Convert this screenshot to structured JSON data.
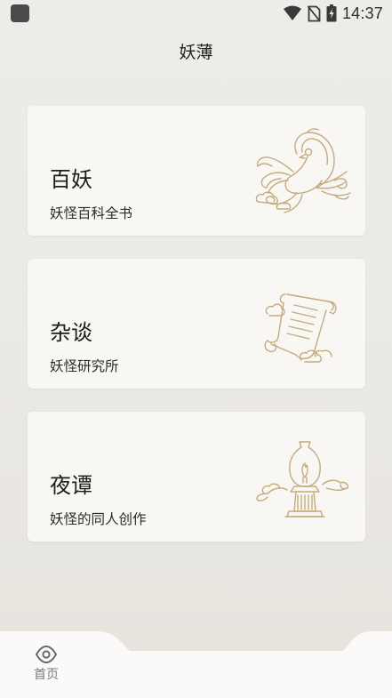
{
  "status_bar": {
    "time": "14:37",
    "icons": [
      "app-notification-icon",
      "wifi-icon",
      "no-sim-icon",
      "battery-charging-icon"
    ]
  },
  "app": {
    "title": "妖薄"
  },
  "cards": [
    {
      "title": "百妖",
      "subtitle": "妖怪百科全书",
      "icon": "phoenix-icon"
    },
    {
      "title": "杂谈",
      "subtitle": "妖怪研究所",
      "icon": "scroll-icon"
    },
    {
      "title": "夜谭",
      "subtitle": "妖怪的同人创作",
      "icon": "oil-lamp-icon"
    }
  ],
  "bottom_nav": {
    "items": [
      {
        "label": "首页",
        "icon": "eye-icon",
        "selected": true
      }
    ]
  },
  "colors": {
    "background": "#ebe9e4",
    "card": "#f8f7f4",
    "illustration_gold": "#c5ab7a",
    "nav_label": "#7a7a7a"
  }
}
